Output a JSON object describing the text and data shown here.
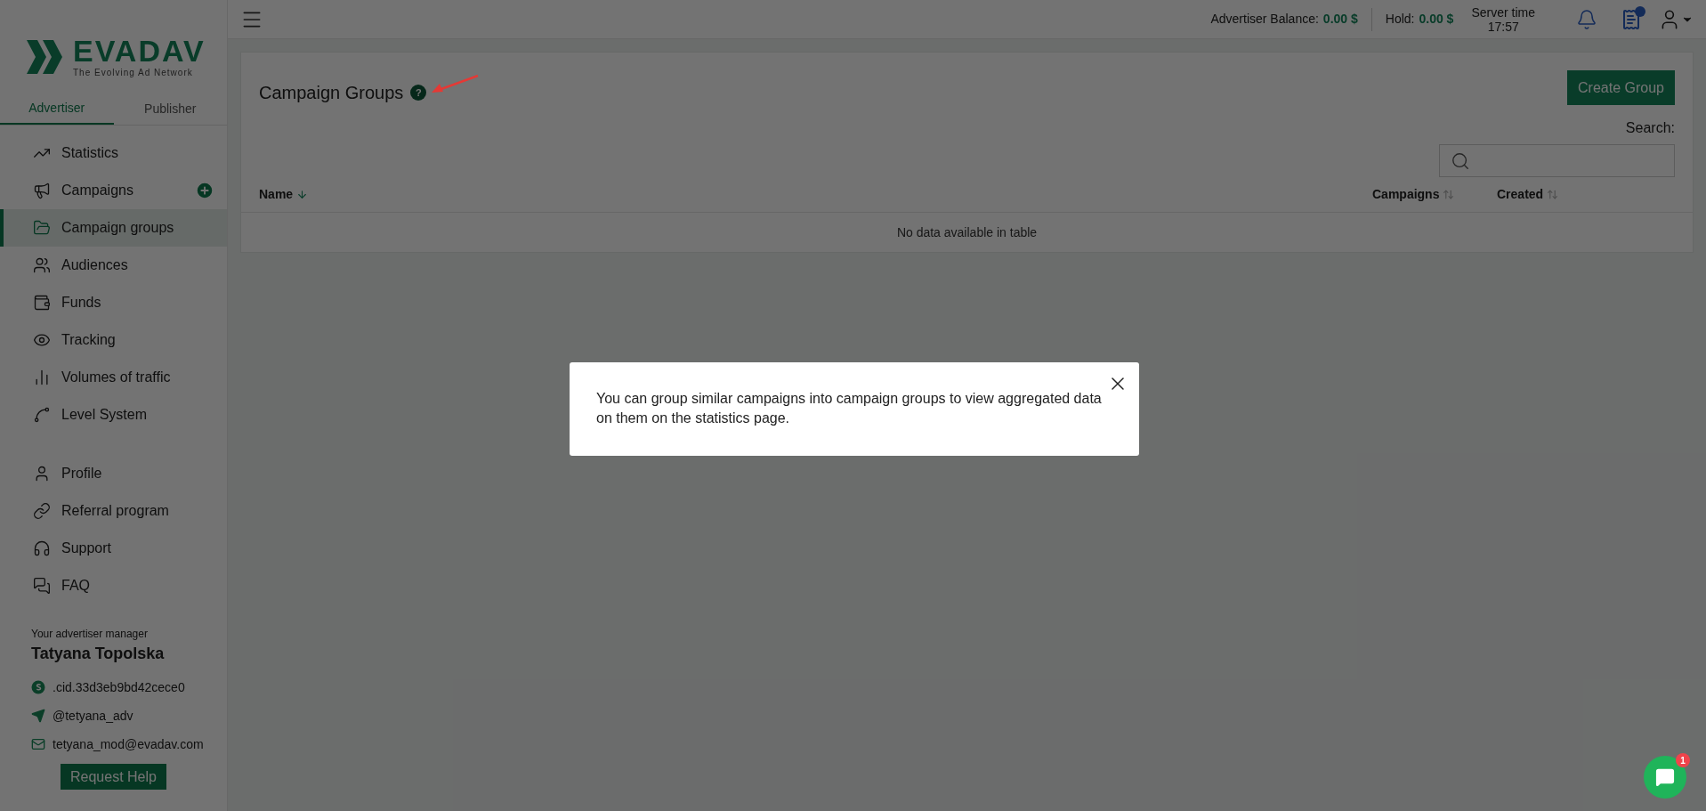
{
  "logo": {
    "name": "EVADAV",
    "tagline": "The Evolving Ad Network"
  },
  "role_tabs": [
    {
      "label": "Advertiser",
      "selected": true
    },
    {
      "label": "Publisher",
      "selected": false
    }
  ],
  "nav": [
    {
      "label": "Statistics",
      "selected": false,
      "add": false
    },
    {
      "label": "Campaigns",
      "selected": false,
      "add": true
    },
    {
      "label": "Campaign groups",
      "selected": true,
      "add": false
    },
    {
      "label": "Audiences",
      "selected": false,
      "add": false
    },
    {
      "label": "Funds",
      "selected": false,
      "add": false
    },
    {
      "label": "Tracking",
      "selected": false,
      "add": false
    },
    {
      "label": "Volumes of traffic",
      "selected": false,
      "add": false
    },
    {
      "label": "Level System",
      "selected": false,
      "add": false
    }
  ],
  "nav_secondary": [
    {
      "label": "Profile",
      "selected": false,
      "add": false
    },
    {
      "label": "Referral program",
      "selected": false,
      "add": false
    },
    {
      "label": "Support",
      "selected": false,
      "add": false
    },
    {
      "label": "FAQ",
      "selected": false,
      "add": false
    }
  ],
  "manager": {
    "caption": "Your advertiser manager",
    "name": "Tatyana Topolska",
    "contacts": [
      {
        "kind": "skype",
        "text": ".cid.33d3eb9bd42cece0"
      },
      {
        "kind": "telegram",
        "text": "@tetyana_adv"
      },
      {
        "kind": "mail",
        "text": "tetyana_mod@evadav.com"
      }
    ],
    "button": "Request Help"
  },
  "header": {
    "balance_label": "Advertiser Balance:",
    "balance_value": "0.00 $",
    "hold_label": "Hold:",
    "hold_value": "0.00 $",
    "server_time_label": "Server time",
    "server_time_value": "17:57",
    "docs_unread": true
  },
  "page": {
    "title": "Campaign Groups",
    "help_mark": "?",
    "create_button": "Create Group",
    "search_label": "Search:",
    "columns": [
      {
        "label": "Name",
        "sorted": true
      },
      {
        "label": "Campaigns",
        "sorted": false
      },
      {
        "label": "Created",
        "sorted": false
      }
    ],
    "empty_text": "No data available in table"
  },
  "modal": {
    "text": "You can group similar campaigns into campaign groups to view aggregated data on them on the statistics page."
  },
  "chat": {
    "badge": "1"
  }
}
